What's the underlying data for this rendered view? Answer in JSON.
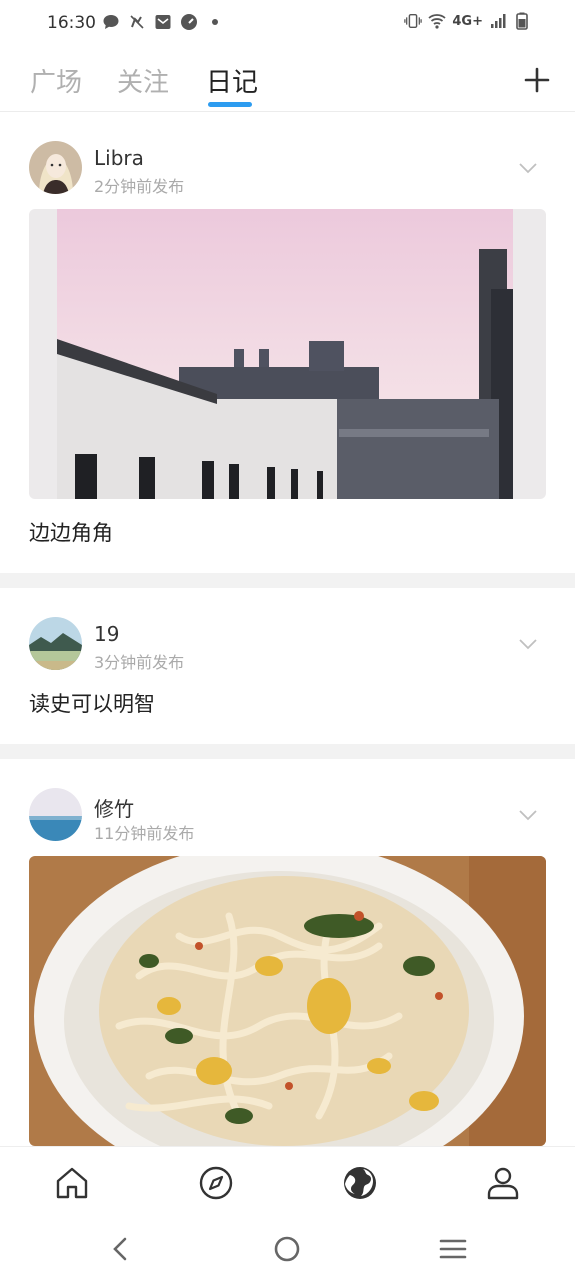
{
  "status_bar": {
    "time": "16:30",
    "network": "4G+",
    "left_icons": [
      "chat-icon",
      "muted-icon",
      "mail-icon",
      "speedometer-icon",
      "dot-icon"
    ],
    "right_icons": [
      "vibrate-icon",
      "wifi-icon",
      "signal-icon",
      "battery-icon"
    ]
  },
  "tabs": [
    {
      "label": "广场"
    },
    {
      "label": "关注"
    },
    {
      "label": "日记"
    }
  ],
  "active_tab": "日记",
  "accent_color": "#2d9cf0",
  "posts": [
    {
      "user": "Libra",
      "time": "2分钟前发布",
      "text": "边边角角",
      "image": "sunset-buildings-photo"
    },
    {
      "user": "19",
      "time": "3分钟前发布",
      "text": "读史可以明智"
    },
    {
      "user": "修竹",
      "time": "11分钟前发布",
      "image": "noodles-photo"
    }
  ],
  "bottom_nav": [
    "home-icon",
    "compass-icon",
    "globe-icon",
    "profile-icon"
  ],
  "system_nav": [
    "back-icon",
    "home-circle-icon",
    "menu-icon"
  ]
}
